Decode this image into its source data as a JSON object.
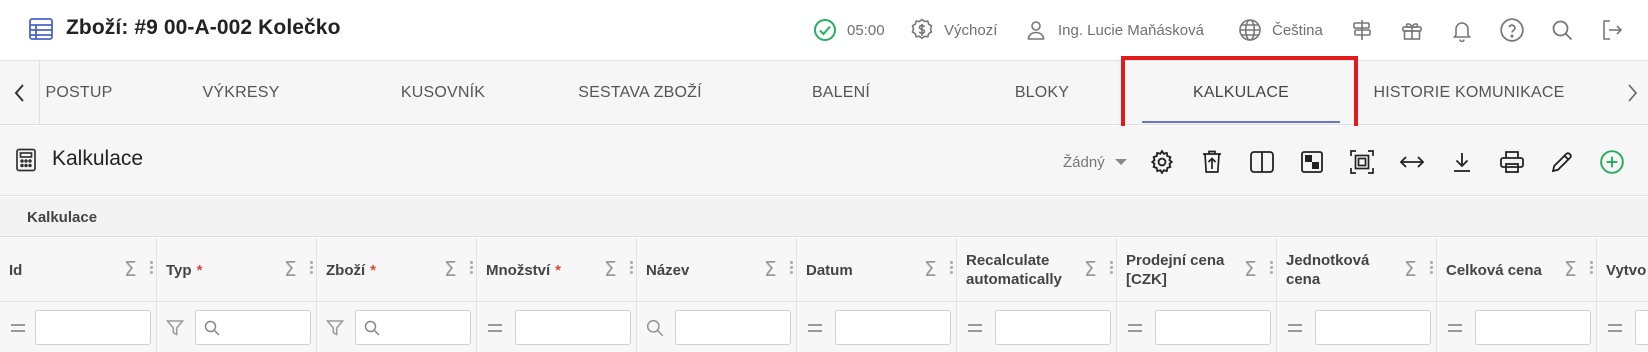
{
  "header": {
    "title": "Zboží: #9 00-A-002 Kolečko",
    "time": "05:00",
    "currency_mode": "Výchozí",
    "user": "Ing. Lucie Maňásková",
    "language": "Čeština"
  },
  "tabs": [
    {
      "label": "POSTUP"
    },
    {
      "label": "VÝKRESY"
    },
    {
      "label": "KUSOVNÍK"
    },
    {
      "label": "SESTAVA ZBOŽÍ"
    },
    {
      "label": "BALENÍ"
    },
    {
      "label": "BLOKY"
    },
    {
      "label": "KALKULACE",
      "active": true
    },
    {
      "label": "HISTORIE KOMUNIKACE"
    }
  ],
  "section": {
    "title": "Kalkulace",
    "selector_value": "Žádný",
    "subheader": "Kalkulace"
  },
  "columns": [
    {
      "label": "Id",
      "required": false
    },
    {
      "label": "Typ",
      "required": true,
      "req_mark": "*"
    },
    {
      "label": "Zboží",
      "required": true,
      "req_mark": "*"
    },
    {
      "label": "Množství",
      "required": true,
      "req_mark": "*"
    },
    {
      "label": "Název",
      "required": false
    },
    {
      "label": "Datum",
      "required": false
    },
    {
      "label": "Recalculate automatically",
      "required": false
    },
    {
      "label": "Prodejní cena [CZK]",
      "required": false
    },
    {
      "label": "Jednotková cena",
      "required": false
    },
    {
      "label": "Celková cena",
      "required": false
    },
    {
      "label": "Vytvo",
      "required": false
    }
  ],
  "sigma_symbol": "Σ",
  "colors": {
    "accent": "#6b74c0",
    "highlight": "#e11b1b",
    "success": "#27ae60",
    "add": "#27ae60"
  }
}
